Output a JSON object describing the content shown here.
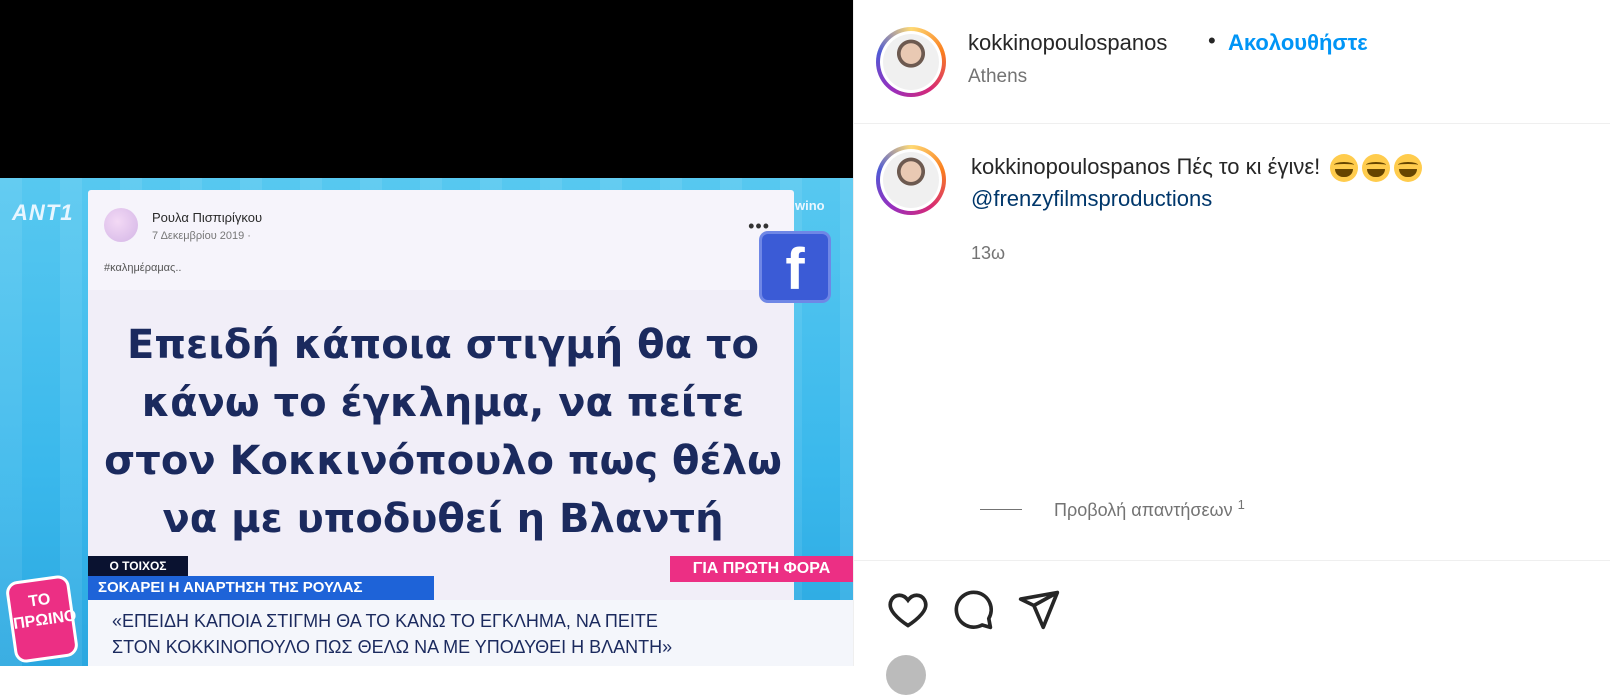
{
  "post_image": {
    "channel_logo": "ANT1",
    "corner_text": "wino",
    "fb_post": {
      "author": "Ρουλα Πισπιρίγκου",
      "date": "7 Δεκεμβρίου 2019 · ",
      "hashtag": "#καλημέραμας..",
      "body": "Επειδή κάποια στιγμή θα το κάνω το έγκλημα, να πείτε στον Κοκκινόπουλο πως θέλω να με υποδυθεί η Βλαντή"
    },
    "ticker": {
      "label": "Ο ΤΟΙΧΟΣ",
      "headline": "ΣΟΚΑΡΕΙ Η ΑΝΑΡΤΗΣΗ ΤΗΣ ΡΟΥΛΑΣ",
      "badge": "ΓΙΑ ΠΡΩΤΗ ΦΟΡΑ",
      "quote_line1": "«ΕΠΕΙΔΗ ΚΑΠΟΙΑ ΣΤΙΓΜΗ ΘΑ ΤΟ ΚΑΝΩ ΤΟ ΕΓΚΛΗΜΑ, ΝΑ ΠΕΙΤΕ",
      "quote_line2": "ΣΤΟΝ ΚΟΚΚΙΝΟΠΟΥΛΟ ΠΩΣ ΘΕΛΩ ΝΑ ΜΕ ΥΠΟΔΥΘΕΙ Η ΒΛΑΝΤΗ»"
    },
    "show_logo": "ΤΟ ΠΡΩΙΝΟ"
  },
  "header": {
    "username": "kokkinopoulospanos",
    "separator": "•",
    "follow_label": "Ακολουθήστε",
    "location": "Athens"
  },
  "caption": {
    "username": "kokkinopoulospanos",
    "text": "Πές το κι έγινε!",
    "mention": "@frenzyfilmsproductions",
    "time": "13ω"
  },
  "replies": {
    "label": "Προβολή απαντήσεων",
    "count": "1"
  },
  "colors": {
    "follow": "#0095f6",
    "mention": "#00376b",
    "muted": "#737373"
  },
  "icons": [
    "heart-icon",
    "comment-icon",
    "share-icon",
    "facebook-icon",
    "laughing-emoji-icon"
  ]
}
